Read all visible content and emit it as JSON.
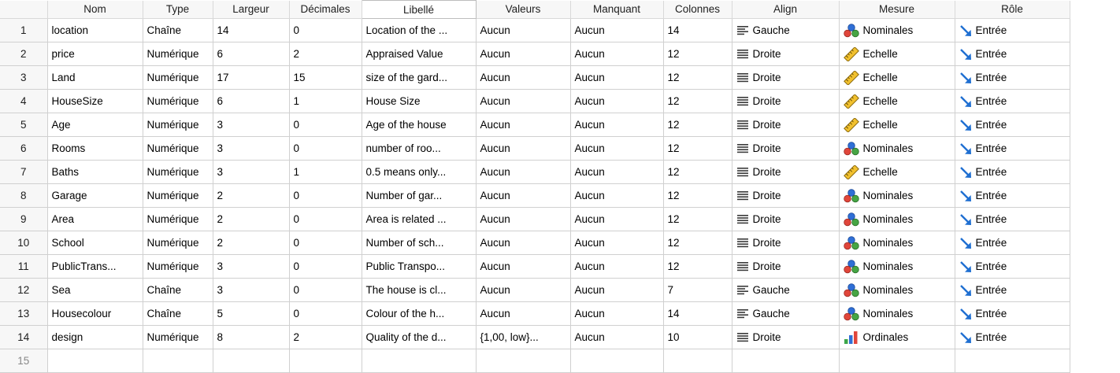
{
  "columns": [
    "Nom",
    "Type",
    "Largeur",
    "Décimales",
    "Libellé",
    "Valeurs",
    "Manquant",
    "Colonnes",
    "Align",
    "Mesure",
    "Rôle"
  ],
  "align_icons": {
    "Gauche": "align-left-icon",
    "Droite": "align-right-icon"
  },
  "measure_icons": {
    "Nominales": "nominal-measure-icon",
    "Echelle": "scale-ruler-icon",
    "Ordinales": "ordinal-bars-icon"
  },
  "role_icon": "input-arrow-icon",
  "rows": [
    {
      "num": "1",
      "nom": "location",
      "type": "Chaîne",
      "largeur": "14",
      "decimales": "0",
      "libelle": "Location of the ...",
      "valeurs": "Aucun",
      "manquant": "Aucun",
      "colonnes": "14",
      "align": "Gauche",
      "mesure": "Nominales",
      "role": "Entrée"
    },
    {
      "num": "2",
      "nom": "price",
      "type": "Numérique",
      "largeur": "6",
      "decimales": "2",
      "libelle": "Appraised Value",
      "valeurs": "Aucun",
      "manquant": "Aucun",
      "colonnes": "12",
      "align": "Droite",
      "mesure": "Echelle",
      "role": "Entrée"
    },
    {
      "num": "3",
      "nom": "Land",
      "type": "Numérique",
      "largeur": "17",
      "decimales": "15",
      "libelle": "size of the gard...",
      "valeurs": "Aucun",
      "manquant": "Aucun",
      "colonnes": "12",
      "align": "Droite",
      "mesure": "Echelle",
      "role": "Entrée"
    },
    {
      "num": "4",
      "nom": "HouseSize",
      "type": "Numérique",
      "largeur": "6",
      "decimales": "1",
      "libelle": "House Size",
      "valeurs": "Aucun",
      "manquant": "Aucun",
      "colonnes": "12",
      "align": "Droite",
      "mesure": "Echelle",
      "role": "Entrée"
    },
    {
      "num": "5",
      "nom": "Age",
      "type": "Numérique",
      "largeur": "3",
      "decimales": "0",
      "libelle": "Age of the house",
      "valeurs": "Aucun",
      "manquant": "Aucun",
      "colonnes": "12",
      "align": "Droite",
      "mesure": "Echelle",
      "role": "Entrée"
    },
    {
      "num": "6",
      "nom": "Rooms",
      "type": "Numérique",
      "largeur": "3",
      "decimales": "0",
      "libelle": "number of roo...",
      "valeurs": "Aucun",
      "manquant": "Aucun",
      "colonnes": "12",
      "align": "Droite",
      "mesure": "Nominales",
      "role": "Entrée"
    },
    {
      "num": "7",
      "nom": "Baths",
      "type": "Numérique",
      "largeur": "3",
      "decimales": "1",
      "libelle": "0.5 means only...",
      "valeurs": "Aucun",
      "manquant": "Aucun",
      "colonnes": "12",
      "align": "Droite",
      "mesure": "Echelle",
      "role": "Entrée"
    },
    {
      "num": "8",
      "nom": "Garage",
      "type": "Numérique",
      "largeur": "2",
      "decimales": "0",
      "libelle": "Number of gar...",
      "valeurs": "Aucun",
      "manquant": "Aucun",
      "colonnes": "12",
      "align": "Droite",
      "mesure": "Nominales",
      "role": "Entrée"
    },
    {
      "num": "9",
      "nom": "Area",
      "type": "Numérique",
      "largeur": "2",
      "decimales": "0",
      "libelle": "Area is related ...",
      "valeurs": "Aucun",
      "manquant": "Aucun",
      "colonnes": "12",
      "align": "Droite",
      "mesure": "Nominales",
      "role": "Entrée"
    },
    {
      "num": "10",
      "nom": "School",
      "type": "Numérique",
      "largeur": "2",
      "decimales": "0",
      "libelle": "Number of sch...",
      "valeurs": "Aucun",
      "manquant": "Aucun",
      "colonnes": "12",
      "align": "Droite",
      "mesure": "Nominales",
      "role": "Entrée"
    },
    {
      "num": "11",
      "nom": "PublicTrans...",
      "type": "Numérique",
      "largeur": "3",
      "decimales": "0",
      "libelle": "Public Transpo...",
      "valeurs": "Aucun",
      "manquant": "Aucun",
      "colonnes": "12",
      "align": "Droite",
      "mesure": "Nominales",
      "role": "Entrée"
    },
    {
      "num": "12",
      "nom": "Sea",
      "type": "Chaîne",
      "largeur": "3",
      "decimales": "0",
      "libelle": "The house is cl...",
      "valeurs": "Aucun",
      "manquant": "Aucun",
      "colonnes": "7",
      "align": "Gauche",
      "mesure": "Nominales",
      "role": "Entrée"
    },
    {
      "num": "13",
      "nom": "Housecolour",
      "type": "Chaîne",
      "largeur": "5",
      "decimales": "0",
      "libelle": "Colour of the h...",
      "valeurs": "Aucun",
      "manquant": "Aucun",
      "colonnes": "14",
      "align": "Gauche",
      "mesure": "Nominales",
      "role": "Entrée"
    },
    {
      "num": "14",
      "nom": "design",
      "type": "Numérique",
      "largeur": "8",
      "decimales": "2",
      "libelle": "Quality of the d...",
      "valeurs": "{1,00, low}...",
      "manquant": "Aucun",
      "colonnes": "10",
      "align": "Droite",
      "mesure": "Ordinales",
      "role": "Entrée"
    }
  ],
  "empty_row_num": "15"
}
